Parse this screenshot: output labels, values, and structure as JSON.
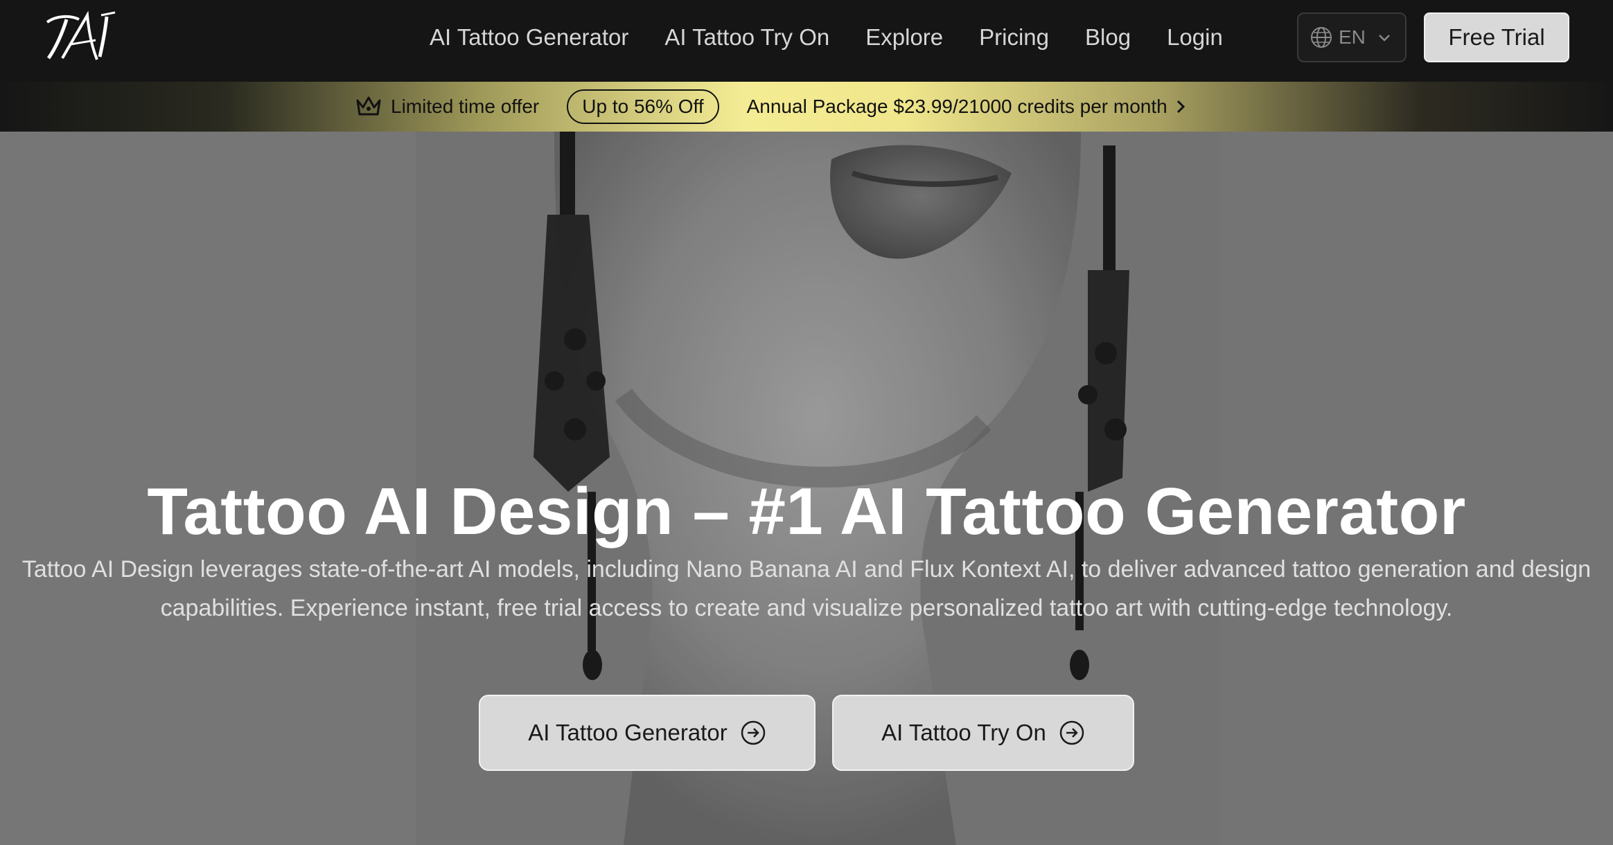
{
  "brand": {
    "logo_text": "TAI"
  },
  "nav": {
    "links": [
      {
        "label": "AI Tattoo Generator"
      },
      {
        "label": "AI Tattoo Try On"
      },
      {
        "label": "Explore"
      },
      {
        "label": "Pricing"
      },
      {
        "label": "Blog"
      },
      {
        "label": "Login"
      }
    ],
    "language": "EN",
    "cta_label": "Free Trial"
  },
  "promo": {
    "offer_label": "Limited time offer",
    "discount_label": "Up to 56% Off",
    "package_label": "Annual Package $23.99/21000 credits per month",
    "icons": [
      "crown-icon",
      "chevron-right-icon"
    ]
  },
  "hero": {
    "title": "Tattoo AI Design – #1 AI Tattoo Generator",
    "description": "Tattoo AI Design leverages state-of-the-art AI models, including Nano Banana AI and Flux Kontext AI, to deliver advanced tattoo generation and design capabilities. Experience instant, free trial access to create and visualize personalized tattoo art with cutting-edge technology.",
    "buttons": [
      {
        "label": "AI Tattoo Generator",
        "icon": "circle-arrow-right-icon"
      },
      {
        "label": "AI Tattoo Try On",
        "icon": "circle-arrow-right-icon"
      }
    ]
  },
  "colors": {
    "nav_background": "#151515",
    "banner_gold": "#f0e68c",
    "button_background": "#d8d8d8"
  }
}
